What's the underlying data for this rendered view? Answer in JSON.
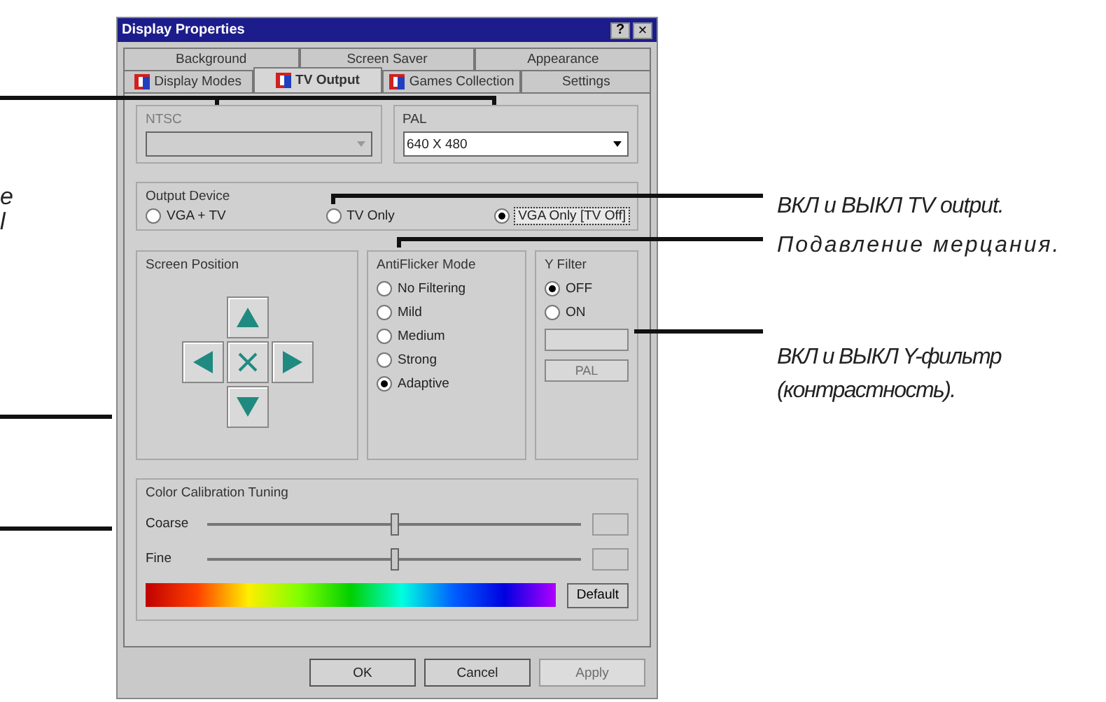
{
  "left_fragments": [
    "e",
    "l"
  ],
  "window": {
    "title": "Display Properties"
  },
  "title_buttons": [
    {
      "kind": "help",
      "label": "?"
    },
    {
      "kind": "close",
      "label": "×"
    }
  ],
  "tab_rows": [
    {
      "tabs": [
        {
          "label": "Background",
          "has_icon": false,
          "selected": false
        },
        {
          "label": "Screen Saver",
          "has_icon": false,
          "selected": false
        },
        {
          "label": "Appearance",
          "has_icon": false,
          "selected": false
        }
      ]
    },
    {
      "tabs": [
        {
          "label": "Display Modes",
          "has_icon": true,
          "selected": false
        },
        {
          "label": "TV Output",
          "has_icon": true,
          "selected": true
        },
        {
          "label": "Games Collection",
          "has_icon": true,
          "selected": false
        },
        {
          "label": "Settings",
          "has_icon": false,
          "selected": false
        }
      ]
    }
  ],
  "standards": [
    {
      "label": "NTSC",
      "disabled": true
    },
    {
      "label": "PAL",
      "disabled": false,
      "value": "640 X 480"
    }
  ],
  "output_device": {
    "label": "Output Device",
    "options": [
      {
        "label": "VGA + TV",
        "selected": false
      },
      {
        "label": "TV Only",
        "selected": false
      },
      {
        "label": "VGA Only [TV Off]",
        "selected": true
      }
    ]
  },
  "screen_position": {
    "label": "Screen Position",
    "buttons": [
      {
        "kind": "up"
      },
      {
        "kind": "left"
      },
      {
        "kind": "center"
      },
      {
        "kind": "right"
      },
      {
        "kind": "down"
      }
    ]
  },
  "antiflicker": {
    "label": "AntiFlicker Mode",
    "options": [
      {
        "label": "No Filtering",
        "selected": false
      },
      {
        "label": "Mild",
        "selected": false
      },
      {
        "label": "Medium",
        "selected": false
      },
      {
        "label": "Strong",
        "selected": false
      },
      {
        "label": "Adaptive",
        "selected": true
      }
    ]
  },
  "y_filter": {
    "label": "Y Filter",
    "options": [
      {
        "label": "OFF",
        "selected": true
      },
      {
        "label": "ON",
        "selected": false
      }
    ],
    "buttons": [
      {
        "disabled": true
      },
      {
        "label": "PAL",
        "disabled": true
      }
    ]
  },
  "color_calibration": {
    "label": "Color Calibration Tuning",
    "sliders": [
      {
        "label": "Coarse",
        "level": 0.5
      },
      {
        "label": "Fine",
        "level": 0.5
      }
    ],
    "default_button": "Default"
  },
  "buttons": [
    {
      "label": "OK",
      "disabled": false
    },
    {
      "label": "Cancel",
      "disabled": false
    },
    {
      "label": "Apply",
      "disabled": true
    }
  ],
  "annotations": [
    {
      "text": "ВКЛ и ВЫКЛ TV output."
    },
    {
      "text": "Подавление мерцания."
    },
    {
      "text": "ВКЛ и ВЫКЛ Y-фильтр (контрастность)."
    }
  ]
}
